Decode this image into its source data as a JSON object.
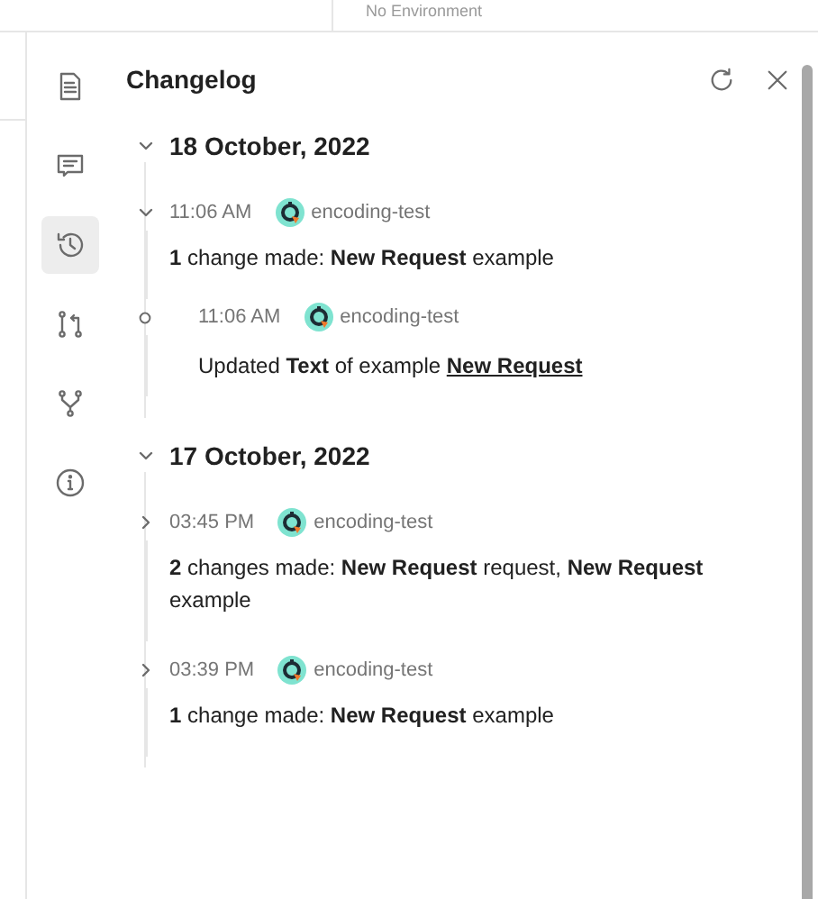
{
  "top_bar": {
    "environment": "No Environment"
  },
  "sidebar": {
    "items": [
      {
        "kind": "document",
        "selected": false
      },
      {
        "kind": "comment",
        "selected": false
      },
      {
        "kind": "history",
        "selected": true
      },
      {
        "kind": "pullrequest",
        "selected": false
      },
      {
        "kind": "fork",
        "selected": false
      },
      {
        "kind": "info",
        "selected": false
      }
    ]
  },
  "panel": {
    "title": "Changelog"
  },
  "groups": [
    {
      "date": "18 October, 2022",
      "expanded": true,
      "entries": [
        {
          "time": "11:06 AM",
          "user": "encoding-test",
          "expanded": true,
          "summary": "**1** change made: **New Request** example",
          "children": [
            {
              "time": "11:06 AM",
              "user": "encoding-test",
              "summary": "Updated **Text** of example",
              "link": "New Request"
            }
          ]
        }
      ]
    },
    {
      "date": "17 October, 2022",
      "expanded": true,
      "entries": [
        {
          "time": "03:45 PM",
          "user": "encoding-test",
          "expanded": false,
          "summary": "**2** changes made: **New Request** request, **New Request** example"
        },
        {
          "time": "03:39 PM",
          "user": "encoding-test",
          "expanded": false,
          "summary": "**1** change made: **New Request** example"
        }
      ]
    }
  ]
}
